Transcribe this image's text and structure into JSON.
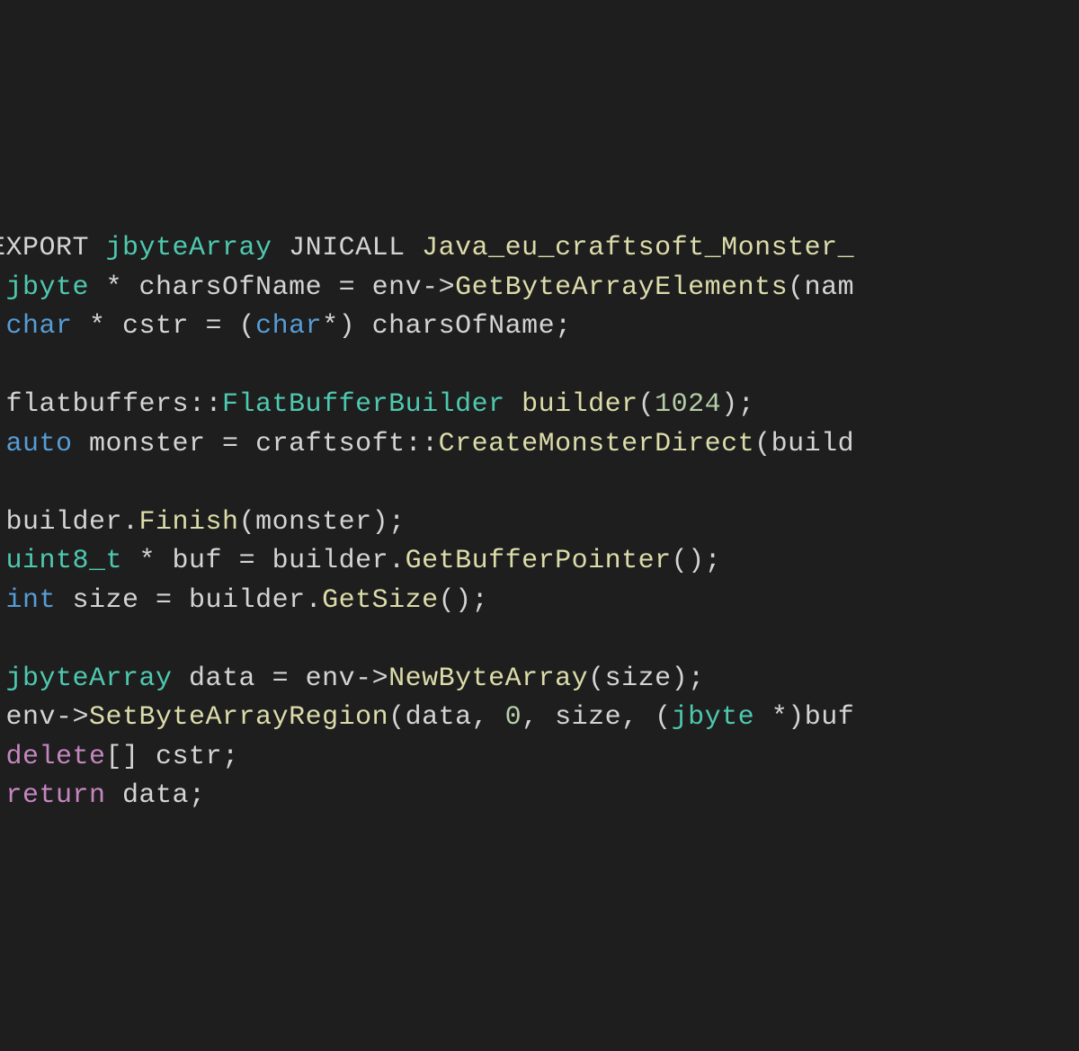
{
  "code": {
    "lines": [
      {
        "tokens": [
          {
            "text": "EXPORT ",
            "cls": "plain"
          },
          {
            "text": "jbyteArray",
            "cls": "type"
          },
          {
            "text": " JNICALL ",
            "cls": "plain"
          },
          {
            "text": "Java_eu_craftsoft_Monster_",
            "cls": "function"
          }
        ]
      },
      {
        "tokens": [
          {
            "text": " ",
            "cls": "plain"
          },
          {
            "text": "jbyte",
            "cls": "type"
          },
          {
            "text": " * charsOfName = env->",
            "cls": "plain"
          },
          {
            "text": "GetByteArrayElements",
            "cls": "function"
          },
          {
            "text": "(nam",
            "cls": "plain"
          }
        ]
      },
      {
        "tokens": [
          {
            "text": " ",
            "cls": "plain"
          },
          {
            "text": "char",
            "cls": "keyword"
          },
          {
            "text": " * cstr = (",
            "cls": "plain"
          },
          {
            "text": "char",
            "cls": "keyword"
          },
          {
            "text": "*) charsOfName;",
            "cls": "plain"
          }
        ]
      },
      {
        "tokens": [
          {
            "text": " ",
            "cls": "plain"
          }
        ]
      },
      {
        "tokens": [
          {
            "text": " flatbuffers::",
            "cls": "plain"
          },
          {
            "text": "FlatBufferBuilder",
            "cls": "type"
          },
          {
            "text": " ",
            "cls": "plain"
          },
          {
            "text": "builder",
            "cls": "function"
          },
          {
            "text": "(",
            "cls": "plain"
          },
          {
            "text": "1024",
            "cls": "number"
          },
          {
            "text": ");",
            "cls": "plain"
          }
        ]
      },
      {
        "tokens": [
          {
            "text": " ",
            "cls": "plain"
          },
          {
            "text": "auto",
            "cls": "keyword"
          },
          {
            "text": " monster = craftsoft::",
            "cls": "plain"
          },
          {
            "text": "CreateMonsterDirect",
            "cls": "function"
          },
          {
            "text": "(build",
            "cls": "plain"
          }
        ]
      },
      {
        "tokens": [
          {
            "text": " ",
            "cls": "plain"
          }
        ]
      },
      {
        "tokens": [
          {
            "text": " builder.",
            "cls": "plain"
          },
          {
            "text": "Finish",
            "cls": "function"
          },
          {
            "text": "(monster);",
            "cls": "plain"
          }
        ]
      },
      {
        "tokens": [
          {
            "text": " ",
            "cls": "plain"
          },
          {
            "text": "uint8_t",
            "cls": "type"
          },
          {
            "text": " * buf = builder.",
            "cls": "plain"
          },
          {
            "text": "GetBufferPointer",
            "cls": "function"
          },
          {
            "text": "();",
            "cls": "plain"
          }
        ]
      },
      {
        "tokens": [
          {
            "text": " ",
            "cls": "plain"
          },
          {
            "text": "int",
            "cls": "keyword"
          },
          {
            "text": " size = builder.",
            "cls": "plain"
          },
          {
            "text": "GetSize",
            "cls": "function"
          },
          {
            "text": "();",
            "cls": "plain"
          }
        ]
      },
      {
        "tokens": [
          {
            "text": " ",
            "cls": "plain"
          }
        ]
      },
      {
        "tokens": [
          {
            "text": " ",
            "cls": "plain"
          },
          {
            "text": "jbyteArray",
            "cls": "type"
          },
          {
            "text": " data = env->",
            "cls": "plain"
          },
          {
            "text": "NewByteArray",
            "cls": "function"
          },
          {
            "text": "(size);",
            "cls": "plain"
          }
        ]
      },
      {
        "tokens": [
          {
            "text": " env->",
            "cls": "plain"
          },
          {
            "text": "SetByteArrayRegion",
            "cls": "function"
          },
          {
            "text": "(data, ",
            "cls": "plain"
          },
          {
            "text": "0",
            "cls": "number"
          },
          {
            "text": ", size, (",
            "cls": "plain"
          },
          {
            "text": "jbyte",
            "cls": "type"
          },
          {
            "text": " *)buf",
            "cls": "plain"
          }
        ]
      },
      {
        "tokens": [
          {
            "text": " ",
            "cls": "plain"
          },
          {
            "text": "delete",
            "cls": "keyword-control"
          },
          {
            "text": "[] cstr;",
            "cls": "plain"
          }
        ]
      },
      {
        "tokens": [
          {
            "text": " ",
            "cls": "plain"
          },
          {
            "text": "return",
            "cls": "keyword-control"
          },
          {
            "text": " data;",
            "cls": "plain"
          }
        ]
      }
    ]
  }
}
